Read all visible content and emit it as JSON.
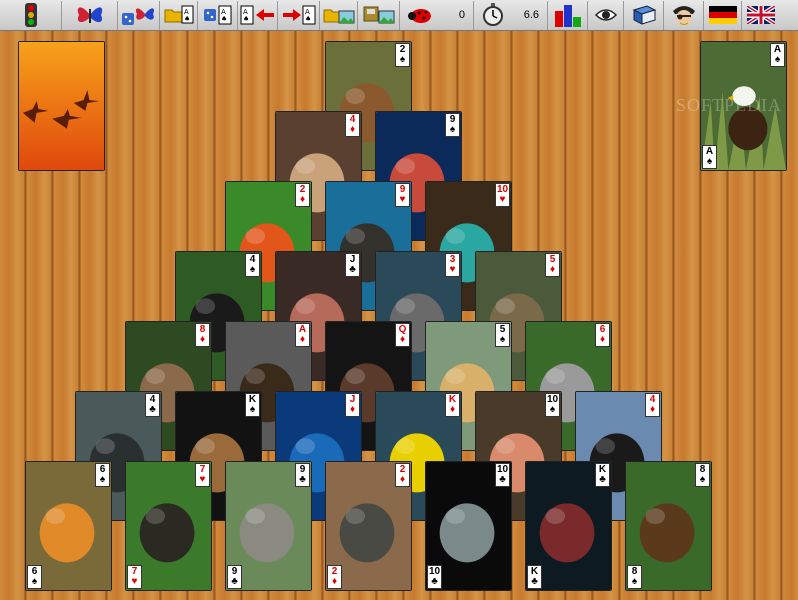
{
  "toolbar": {
    "score": "0",
    "time": "6.6",
    "icons": [
      "traffic-light-icon",
      "butterfly-icon",
      "dice-butterfly-icon",
      "open-folder-card-icon",
      "dice-card-icon",
      "card-arrow-left-icon",
      "arrow-card-right-icon",
      "folder-landscape-icon",
      "save-landscape-icon",
      "ladybug-icon",
      "stopwatch-icon",
      "bar-chart-icon",
      "eye-icon",
      "book-icon",
      "pirate-icon",
      "german-flag-icon",
      "uk-flag-icon"
    ]
  },
  "stock": {
    "image": "cranes-sunset",
    "colors": [
      "#f7a21b",
      "#e0480c"
    ]
  },
  "waste": {
    "rank": "A",
    "suit": "♠",
    "color": "black",
    "image": "bald-eagle"
  },
  "watermark": "SOFTPEDIA",
  "pyramid": [
    [
      {
        "rank": "2",
        "suit": "♠",
        "color": "black",
        "image": "capybara"
      }
    ],
    [
      {
        "rank": "4",
        "suit": "♦",
        "color": "red",
        "image": "walrus"
      },
      {
        "rank": "9",
        "suit": "♠",
        "color": "black",
        "image": "fish"
      }
    ],
    [
      {
        "rank": "2",
        "suit": "♦",
        "color": "red",
        "image": "frog"
      },
      {
        "rank": "9",
        "suit": "♥",
        "color": "red",
        "image": "sea-lion"
      },
      {
        "rank": "10",
        "suit": "♥",
        "color": "red",
        "image": "parrotfish"
      }
    ],
    [
      {
        "rank": "4",
        "suit": "♠",
        "color": "black",
        "image": "gorilla"
      },
      {
        "rank": "J",
        "suit": "♣",
        "color": "black",
        "image": "bat"
      },
      {
        "rank": "3",
        "suit": "♥",
        "color": "red",
        "image": "hippo"
      },
      {
        "rank": "5",
        "suit": "♦",
        "color": "red",
        "image": "tortoise"
      }
    ],
    [
      {
        "rank": "8",
        "suit": "♦",
        "color": "red",
        "image": "sloth"
      },
      {
        "rank": "A",
        "suit": "♦",
        "color": "red",
        "image": "otter"
      },
      {
        "rank": "Q",
        "suit": "♦",
        "color": "red",
        "image": "vulture"
      },
      {
        "rank": "5",
        "suit": "♠",
        "color": "black",
        "image": "leopard"
      },
      {
        "rank": "6",
        "suit": "♦",
        "color": "red",
        "image": "koala"
      }
    ],
    [
      {
        "rank": "4",
        "suit": "♣",
        "color": "black",
        "image": "seal"
      },
      {
        "rank": "K",
        "suit": "♠",
        "color": "black",
        "image": "bone"
      },
      {
        "rank": "J",
        "suit": "♦",
        "color": "red",
        "image": "dolphins"
      },
      {
        "rank": "K",
        "suit": "♦",
        "color": "red",
        "image": "eel"
      },
      {
        "rank": "10",
        "suit": "♠",
        "color": "black",
        "image": "octopus"
      },
      {
        "rank": "4",
        "suit": "♦",
        "color": "red",
        "image": "penguin"
      }
    ],
    [
      {
        "rank": "6",
        "suit": "♠",
        "color": "black",
        "image": "tiger"
      },
      {
        "rank": "7",
        "suit": "♥",
        "color": "red",
        "image": "anteater"
      },
      {
        "rank": "9",
        "suit": "♣",
        "color": "black",
        "image": "elephants"
      },
      {
        "rank": "2",
        "suit": "♦",
        "color": "red",
        "image": "rhino"
      },
      {
        "rank": "10",
        "suit": "♣",
        "color": "black",
        "image": "shark"
      },
      {
        "rank": "K",
        "suit": "♣",
        "color": "black",
        "image": "lobster"
      },
      {
        "rank": "8",
        "suit": "♠",
        "color": "black",
        "image": "moose"
      }
    ]
  ]
}
